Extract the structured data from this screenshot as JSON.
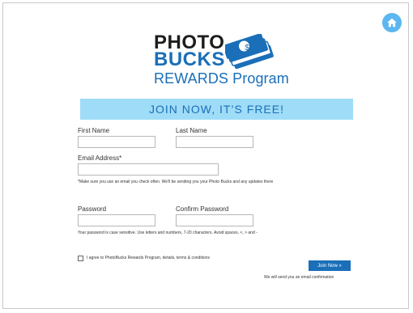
{
  "logo": {
    "line1": "PHOTO",
    "line2": "BUCKS",
    "line3": "REWARDS Program",
    "money_symbol": "$"
  },
  "banner": {
    "text": "JOIN NOW, IT’S FREE!"
  },
  "form": {
    "first_name": {
      "label": "First Name",
      "value": "",
      "placeholder": ""
    },
    "last_name": {
      "label": "Last Name",
      "value": "",
      "placeholder": ""
    },
    "email": {
      "label": "Email Address*",
      "value": "",
      "placeholder": "",
      "note": "*Make sure you use an email you check often. We'll be sending you your Photo Bucks and any updates there"
    },
    "password": {
      "label": "Password",
      "value": "",
      "placeholder": ""
    },
    "confirm_password": {
      "label": "Confirm Password",
      "value": "",
      "placeholder": ""
    },
    "password_note": "Your password is case sensitive. Use letters and numbers, 7-20 characters. Avoid spaces, <, > and -",
    "agree_text": "I agree to PhotoBucks Rewards Program, details, terms & conditions",
    "agree_checked": false,
    "submit_label": "Join Now »",
    "confirmation_note": "We will send you an email confirmation"
  },
  "icons": {
    "home": "home-icon",
    "money": "money-stack-icon"
  },
  "colors": {
    "brand_blue": "#1a6fb8",
    "banner_bg": "#9fdcf7",
    "home_button": "#5cb6f0",
    "dark_text": "#1d1d1b"
  }
}
